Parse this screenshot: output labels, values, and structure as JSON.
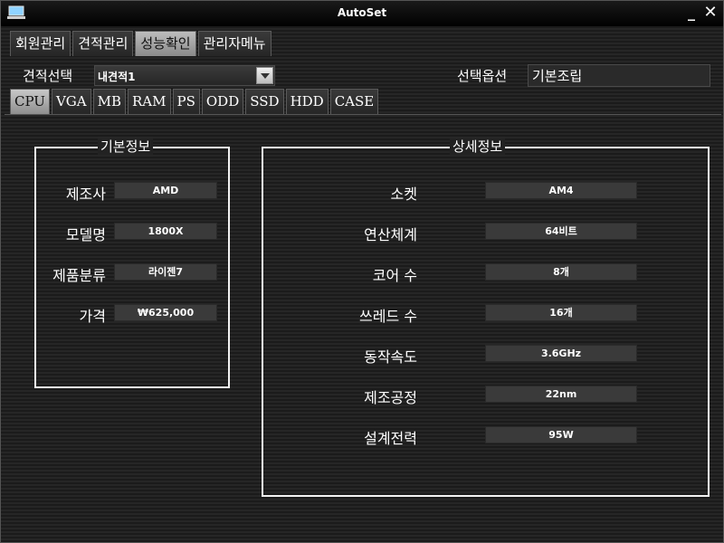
{
  "window": {
    "title": "AutoSet",
    "minimize_glyph": "_",
    "close_glyph": "✕",
    "icon": "monitor-icon"
  },
  "main_tabs": [
    {
      "label": "회원관리",
      "active": false
    },
    {
      "label": "견적관리",
      "active": false
    },
    {
      "label": "성능확인",
      "active": true
    },
    {
      "label": "관리자메뉴",
      "active": false
    }
  ],
  "estimate": {
    "label": "견적선택",
    "selected": "내견적1"
  },
  "option": {
    "label": "선택옵션",
    "value": "기본조립"
  },
  "sub_tabs": [
    {
      "label": "CPU",
      "active": true
    },
    {
      "label": "VGA",
      "active": false
    },
    {
      "label": "MB",
      "active": false
    },
    {
      "label": "RAM",
      "active": false
    },
    {
      "label": "PS",
      "active": false
    },
    {
      "label": "ODD",
      "active": false
    },
    {
      "label": "SSD",
      "active": false
    },
    {
      "label": "HDD",
      "active": false
    },
    {
      "label": "CASE",
      "active": false
    }
  ],
  "basic_info": {
    "title": "기본정보",
    "fields": [
      {
        "label": "제조사",
        "value": "AMD"
      },
      {
        "label": "모델명",
        "value": "1800X"
      },
      {
        "label": "제품분류",
        "value": "라이젠7"
      },
      {
        "label": "가격",
        "value": "₩625,000"
      }
    ]
  },
  "detail_info": {
    "title": "상세정보",
    "fields": [
      {
        "label": "소켓",
        "value": "AM4"
      },
      {
        "label": "연산체계",
        "value": "64비트"
      },
      {
        "label": "코어 수",
        "value": "8개"
      },
      {
        "label": "쓰레드 수",
        "value": "16개"
      },
      {
        "label": "동작속도",
        "value": "3.6GHz"
      },
      {
        "label": "제조공정",
        "value": "22nm"
      },
      {
        "label": "설계전력",
        "value": "95W"
      }
    ]
  },
  "colors": {
    "background": "#222222",
    "group_border": "#f2f2f2",
    "field_bg": "#3a3a3a",
    "active_tab": "#bdbdbd"
  }
}
